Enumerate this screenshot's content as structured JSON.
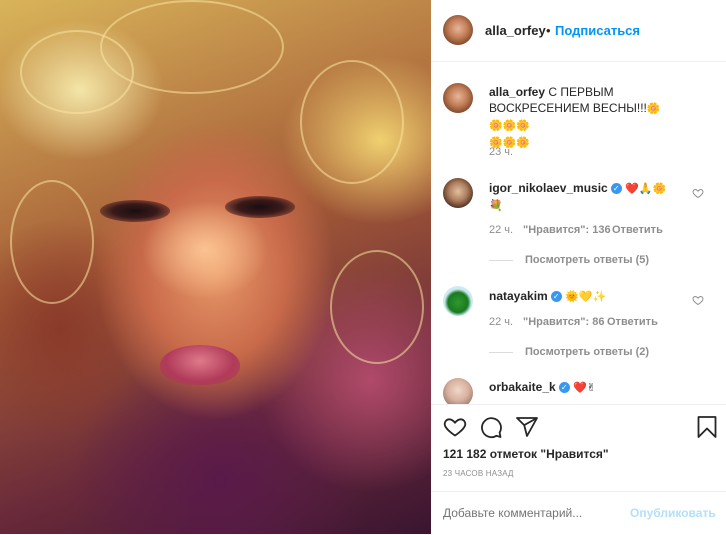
{
  "post": {
    "author": "alla_orfey",
    "follow_label": "Подписаться",
    "caption_user": "alla_orfey",
    "caption_text": "С ПЕРВЫМ ВОСКРЕСЕНИЕМ ВЕСНЫ!!!",
    "caption_emoji_line1": "🌼🌼🌼🌼",
    "caption_emoji_line2": "🌼🌼🌼",
    "caption_time": "23 ч."
  },
  "comments": [
    {
      "user": "igor_nikolaev_music",
      "text": "❤️🙏🌼",
      "text2": "💐",
      "time": "22 ч.",
      "likes": "\"Нравится\": 136",
      "reply": "Ответить",
      "view_replies": "Посмотреть ответы (5)"
    },
    {
      "user": "natayakim",
      "text": "🌞💛✨",
      "time": "22 ч.",
      "likes": "\"Нравится\": 86",
      "reply": "Ответить",
      "view_replies": "Посмотреть ответы (2)"
    },
    {
      "user": "orbakaite_k",
      "text": "❤️✌"
    }
  ],
  "stats": {
    "likes": "121 182 отметок \"Нравится\"",
    "timestamp": "23 ЧАСОВ НАЗАД"
  },
  "add_comment": {
    "placeholder": "Добавьте комментарий...",
    "publish_label": "Опубликовать"
  },
  "colors": {
    "accent": "#0095f6",
    "publish_disabled": "#b2dffc",
    "text": "#262626",
    "muted": "#8e8e8e",
    "verified": "#3897f0"
  },
  "icons": [
    "heart-icon",
    "comment-icon",
    "share-icon",
    "bookmark-icon",
    "verified-icon",
    "small-heart-icon"
  ]
}
